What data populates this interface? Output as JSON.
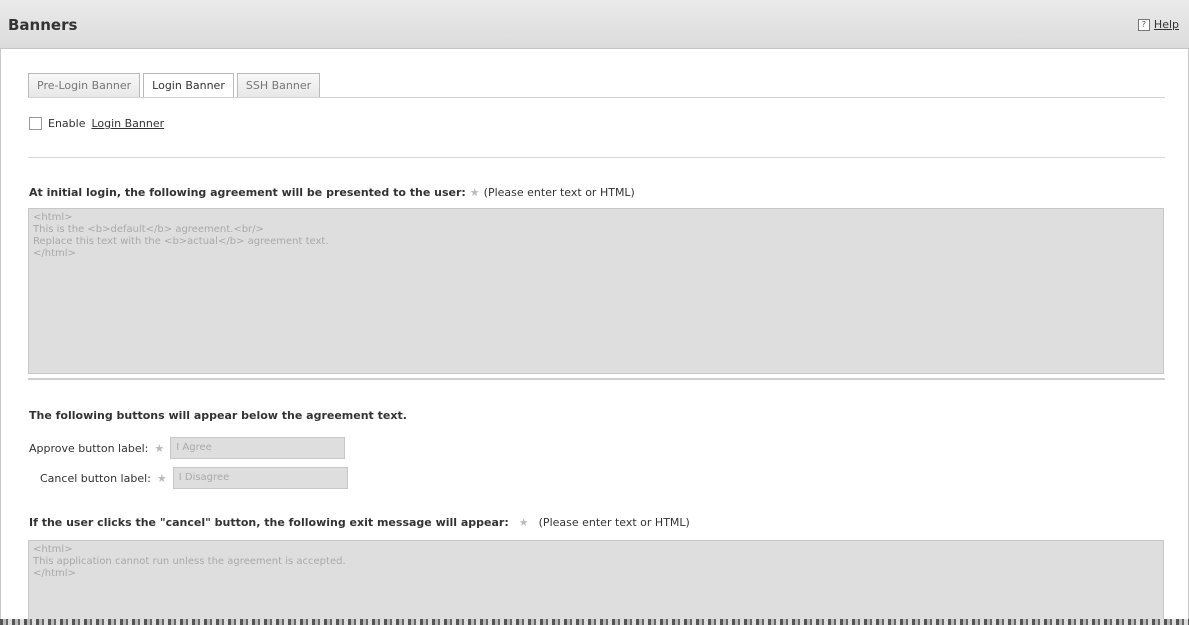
{
  "header": {
    "title": "Banners",
    "help_icon": "?",
    "help_label": "Help"
  },
  "tabs": [
    {
      "label": "Pre-Login Banner",
      "active": false
    },
    {
      "label": "Login Banner",
      "active": true
    },
    {
      "label": "SSH Banner",
      "active": false
    }
  ],
  "enable": {
    "checked": false,
    "label": "Enable",
    "link": "Login Banner"
  },
  "agreement": {
    "label": "At initial login, the following agreement will be presented to the user:",
    "required_mark": "★",
    "note": "(Please enter text or HTML)",
    "text": "<html>\nThis is the <b>default</b> agreement.<br/>\nReplace this text with the <b>actual</b> agreement text.\n</html>"
  },
  "buttons_section": {
    "label": "The following buttons will appear below the agreement text.",
    "approve": {
      "label": "Approve button label:",
      "required_mark": "★",
      "value": "I Agree"
    },
    "cancel": {
      "label": "Cancel button label:",
      "required_mark": "★",
      "value": "I Disagree"
    }
  },
  "exit_message": {
    "label": "If the user clicks the \"cancel\" button, the following exit message will appear:",
    "required_mark": "★",
    "note": "(Please enter text or HTML)",
    "text": "<html>\nThis application cannot run unless the agreement is accepted.\n</html>"
  }
}
